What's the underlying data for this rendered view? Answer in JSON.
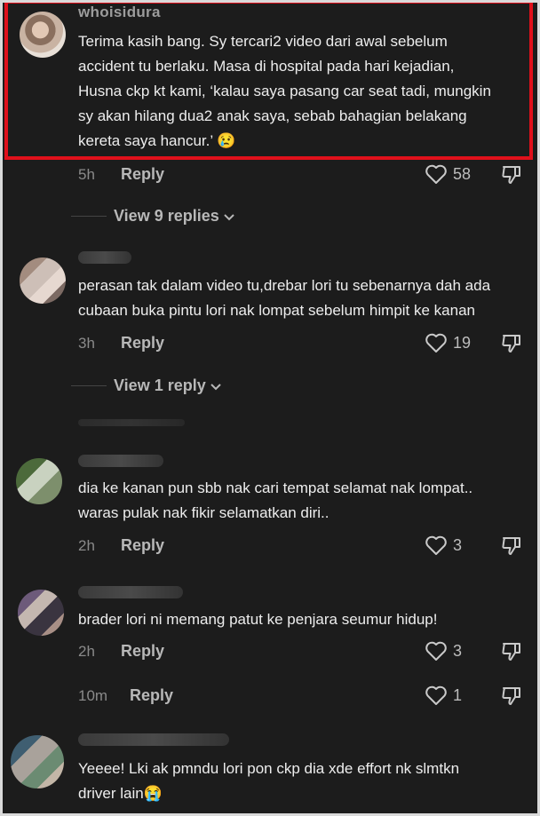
{
  "comments": [
    {
      "username": "whoisidura",
      "lines": [
        "Terima kasih bang. Sy tercari2 video dari awal sebelum",
        "accident tu berlaku. Masa di hospital pada hari kejadian,",
        "Husna ckp kt kami, ‘kalau saya pasang car seat tadi, mungkin",
        "sy akan hilang dua2 anak saya, sebab bahagian belakang",
        "kereta saya hancur.’ 😢"
      ],
      "time": "5h",
      "reply_label": "Reply",
      "likes": "58",
      "view_replies": "View 9 replies"
    },
    {
      "username": "",
      "lines": [
        "perasan tak dalam video tu,drebar lori tu sebenarnya dah ada",
        "cubaan buka pintu lori nak lompat sebelum himpit ke kanan"
      ],
      "time": "3h",
      "reply_label": "Reply",
      "likes": "19",
      "view_replies": "View 1 reply"
    },
    {
      "username": "",
      "lines": [
        "dia ke kanan pun sbb nak cari tempat selamat nak lompat..",
        "waras pulak nak fikir selamatkan diri.."
      ],
      "time": "2h",
      "reply_label": "Reply",
      "likes": "3"
    },
    {
      "username": "",
      "lines": [
        "brader lori ni memang patut ke penjara seumur hidup!"
      ],
      "time": "2h",
      "reply_label": "Reply",
      "likes": "3"
    },
    {
      "username": "",
      "lines": [],
      "time": "10m",
      "reply_label": "Reply",
      "likes": "1"
    },
    {
      "username": "",
      "lines": [
        "Yeeee! Lki ak pmndu lori pon ckp dia xde effort nk slmtkn",
        "driver lain😭"
      ]
    }
  ],
  "icons": {
    "like": "heart-outline-icon",
    "dislike": "thumbs-down-icon",
    "chevron": "chevron-down-icon"
  },
  "colors": {
    "background": "#1c1c1c",
    "highlight_border": "#e0101b"
  }
}
